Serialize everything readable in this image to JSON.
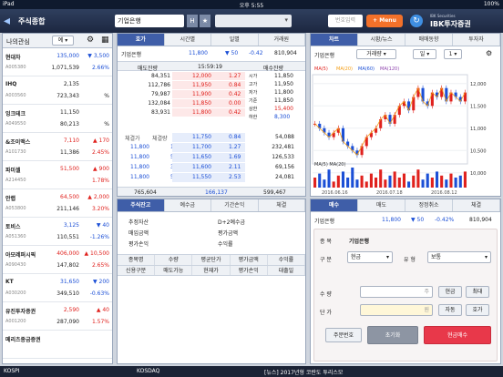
{
  "statusbar": {
    "carrier": "iPad",
    "time": "오후 5:55",
    "battery": "100%"
  },
  "topbar": {
    "title": "주식종합",
    "stock_name": "기업은행",
    "h_badge": "H",
    "star": "★",
    "search_placeholder": "번호입력",
    "menu_label": "+ Menu",
    "brand": "IBK투자증권",
    "brand_sub": "IBK Securities"
  },
  "left": {
    "tabs": [
      "나의관심",
      "예"
    ],
    "items": [
      {
        "name": "현대차",
        "code": "A005380",
        "price": "135,000",
        "change": "▼ 3,500",
        "vol": "1,071,539",
        "rate": "2.66%",
        "dir": "dn"
      },
      {
        "name": "IHQ",
        "code": "A003560",
        "price": "2,135",
        "change": "",
        "vol": "723,343",
        "rate": "%",
        "dir": ""
      },
      {
        "name": "잉크테크",
        "code": "A049550",
        "price": "11,150",
        "change": "",
        "vol": "80,213",
        "rate": "%",
        "dir": ""
      },
      {
        "name": "&조이맥스",
        "code": "A101730",
        "price": "7,110",
        "change": "▲ 170",
        "vol": "11,386",
        "rate": "2.45%",
        "dir": "up"
      },
      {
        "name": "파미셀",
        "code": "A214450",
        "price": "51,500",
        "change": "▲ 900",
        "vol": "",
        "rate": "1.78%",
        "dir": "up"
      },
      {
        "name": "안랩",
        "code": "A053800",
        "price": "64,500",
        "change": "▲ 2,000",
        "vol": "211,146",
        "rate": "3.20%",
        "dir": "up"
      },
      {
        "name": "토비스",
        "code": "A051360",
        "price": "3,125",
        "change": "▼ 40",
        "vol": "110,551",
        "rate": "-1.26%",
        "dir": "dn"
      },
      {
        "name": "아모레퍼시픽",
        "code": "A090430",
        "price": "406,000",
        "change": "▲ 10,500",
        "vol": "147,802",
        "rate": "2.65%",
        "dir": "up"
      },
      {
        "name": "KT",
        "code": "A030200",
        "price": "31,650",
        "change": "▼ 200",
        "vol": "349,510",
        "rate": "-0.63%",
        "dir": "dn"
      },
      {
        "name": "유진투자증권",
        "code": "A001200",
        "price": "2,590",
        "change": "▲ 40",
        "vol": "287,090",
        "rate": "1.57%",
        "dir": "up"
      },
      {
        "name": "메리츠종금증권",
        "code": "",
        "price": "",
        "change": "",
        "vol": "",
        "rate": "",
        "dir": ""
      }
    ]
  },
  "quote": {
    "tabs": [
      "호가",
      "시간별",
      "일별",
      "거래원"
    ],
    "stock": "기업은행",
    "price": "11,800",
    "change": "▼ 50",
    "rate": "-0.42",
    "volume": "810,904",
    "hdr_sell": "매도잔량",
    "hdr_time": "15:59:19",
    "hdr_buy": "매수잔량",
    "asks": [
      [
        "84,351",
        "12,000",
        "1.27"
      ],
      [
        "112,786",
        "11,950",
        "0.84"
      ],
      [
        "79,987",
        "11,900",
        "0.42"
      ],
      [
        "132,084",
        "11,850",
        "0.00"
      ],
      [
        "83,931",
        "11,800",
        "0.42"
      ]
    ],
    "bids": [
      [
        "11,750",
        "0.84",
        "54,088"
      ],
      [
        "11,700",
        "1.27",
        "232,481"
      ],
      [
        "11,650",
        "1.69",
        "126,533"
      ],
      [
        "11,600",
        "2.11",
        "69,156"
      ],
      [
        "11,550",
        "2.53",
        "24,081"
      ]
    ],
    "info": [
      [
        "시가",
        "11,850"
      ],
      [
        "고가",
        "11,950"
      ],
      [
        "저가",
        "11,800"
      ],
      [
        "기준",
        "11,850"
      ],
      [
        "상한",
        "15,400"
      ],
      [
        "하한",
        "8,300"
      ]
    ],
    "trades_hdr": [
      "체결가",
      "체결량"
    ],
    "trades": [
      [
        "11,800",
        "10"
      ],
      [
        "11,800",
        "50"
      ],
      [
        "11,800",
        "3"
      ],
      [
        "11,800",
        "5"
      ]
    ],
    "total_sell": "765,604",
    "total_diff": "166,137",
    "total_buy": "599,467"
  },
  "chart": {
    "tabs": [
      "차트",
      "시황/뉴스",
      "매매동향",
      "투자자"
    ],
    "stock": "기업은행",
    "type": "거래량",
    "period": "일",
    "num": "1",
    "ma_labels": [
      "MA(5)",
      "MA(20)",
      "MA(60)",
      "MA(120)"
    ],
    "yticks": [
      "12,000",
      "11,500",
      "11,000",
      "10,500",
      "10,000"
    ],
    "vol_label": "MA(5) MA(20)",
    "dates": [
      "2016.06.16",
      "2016.07.18",
      "2016.08.12"
    ],
    "candles": [
      11.1,
      11.0,
      10.9,
      10.8,
      10.9,
      11.0,
      10.7,
      10.6,
      10.5,
      10.4,
      10.6,
      10.8,
      10.9,
      11.0,
      11.2,
      11.3,
      11.1,
      11.3,
      11.5,
      11.6,
      11.4,
      11.7,
      11.9,
      11.6,
      11.5,
      11.8,
      11.7,
      11.9,
      11.6,
      11.8,
      11.7,
      11.6,
      11.8
    ],
    "vols": [
      5,
      7,
      4,
      9,
      3,
      6,
      8,
      5,
      10,
      4,
      6,
      3,
      7,
      5,
      9,
      4,
      6,
      8,
      5,
      7,
      3,
      6,
      9,
      4,
      7,
      5,
      8,
      6,
      4,
      7,
      5,
      6,
      8
    ]
  },
  "account": {
    "tabs": [
      "주식잔고",
      "예수금",
      "기간손익",
      "체결"
    ],
    "labels": [
      "추정자산",
      "D+2예수금",
      "매입금액",
      "평가금액",
      "평가손익",
      "수익률"
    ],
    "cols1": [
      "종목명",
      "수량",
      "평균단가",
      "평가금액",
      "수익률"
    ],
    "cols2": [
      "신용구분",
      "매도가능",
      "현재가",
      "평가손익",
      "대출일"
    ]
  },
  "order": {
    "tabs": [
      "매수",
      "매도",
      "정정취소",
      "체결"
    ],
    "stock": "기업은행",
    "price": "11,800",
    "change": "▼ 50",
    "rate": "-0.42%",
    "volume": "810,904",
    "stock_label": "종  목",
    "stock_value": "기업은행",
    "gubun_label": "구  분",
    "gubun_value": "현금",
    "type_label": "유  형",
    "type_value": "보통",
    "qty_label": "수  량",
    "qty_unit": "주",
    "price_label": "단  가",
    "price_unit": "원",
    "cash_btn": "현금",
    "max_btn": "최대",
    "auto_btn": "자동",
    "quote_btn": "호가",
    "order_no_btn": "주문번호",
    "reset_btn": "초기화",
    "buy_btn": "현금매수"
  },
  "bottombar": {
    "left": "KOSPI",
    "mid": "KOSDAQ",
    "news": "[뉴스] 2017년형 코란도 투리스모"
  }
}
